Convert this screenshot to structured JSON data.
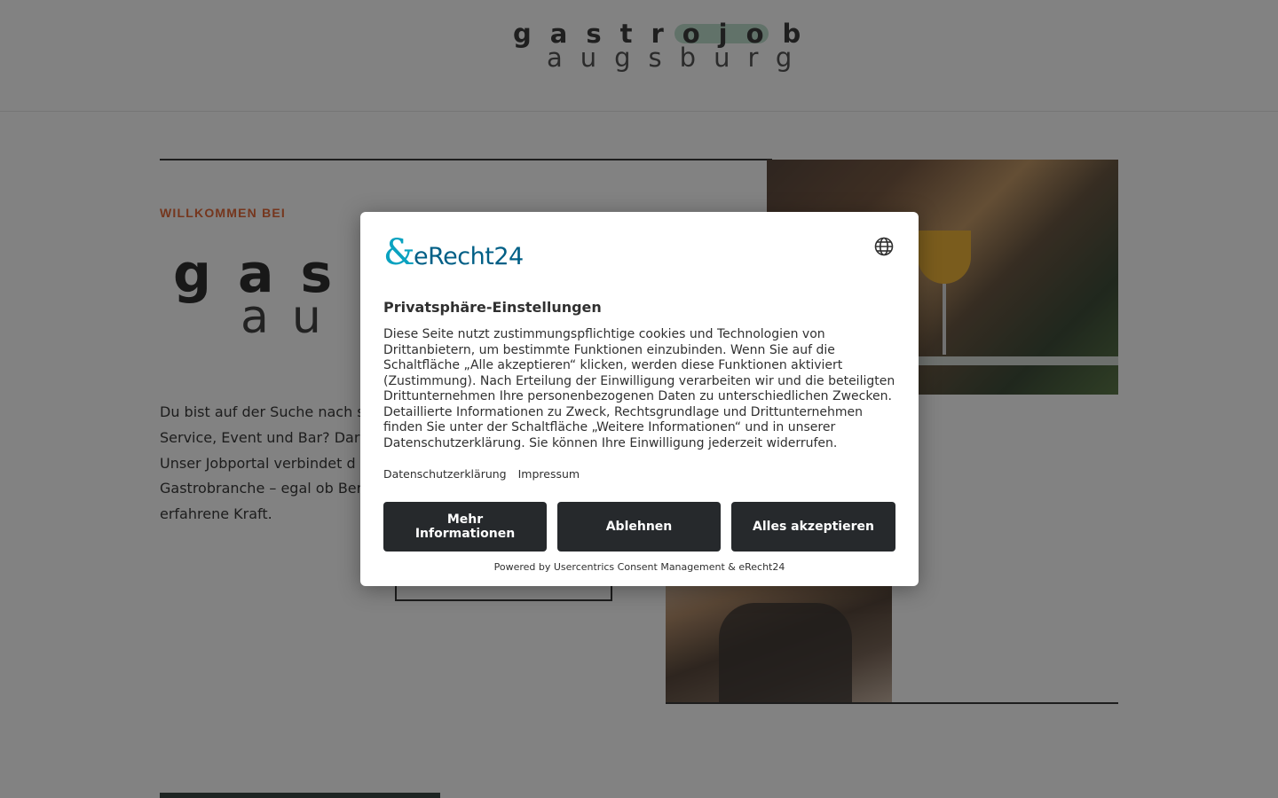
{
  "header": {
    "logo_line1": "gastrojob",
    "logo_line2": "augsburg"
  },
  "hero": {
    "kicker": "WILLKOMMEN BEI",
    "big_logo_line1": "gas",
    "big_logo_line2": "au",
    "intro_lines": [
      "Du bist auf der Suche nach s",
      "Service, Event und Bar? Dar",
      "Unser Jobportal verbindet d",
      "Gastrobranche – egal ob Ber",
      "erfahrene Kraft."
    ]
  },
  "consent": {
    "brand_mark": "&",
    "brand_name": "eRecht24",
    "language_icon": "globe-icon",
    "title": "Privatsphäre-Einstellungen",
    "body_lines": [
      "Diese Seite nutzt zustimmungspflichtige cookies und Technologien von",
      "Drittanbietern, um bestimmte Funktionen einzubinden. Wenn Sie auf die",
      "Schaltfläche „Alle akzeptieren“ klicken, werden diese Funktionen aktiviert",
      "(Zustimmung). Nach Erteilung der Einwilligung verarbeiten wir und die beteiligten",
      "Drittunternehmen Ihre personenbezogenen Daten zu unterschiedlichen Zwecken.",
      "Detaillierte Informationen zu Zweck, Rechtsgrundlage und Drittunternehmen",
      "finden Sie unter der Schaltfläche „Weitere Informationen“ und in unserer",
      "Datenschutzerklärung. Sie können Ihre Einwilligung jederzeit widerrufen."
    ],
    "links": {
      "privacy": "Datenschutzerklärung",
      "imprint": "Impressum"
    },
    "buttons": {
      "more": "Mehr Informationen",
      "deny": "Ablehnen",
      "accept": "Alles akzeptieren"
    },
    "powered_by": "Powered by Usercentrics Consent Management & eRecht24"
  },
  "colors": {
    "accent": "#e56a3a",
    "button_bg": "#26292c",
    "brand_blue": "#005f86",
    "brand_cyan": "#0aa2c0",
    "overlay": "rgba(0,0,0,0.49)"
  }
}
